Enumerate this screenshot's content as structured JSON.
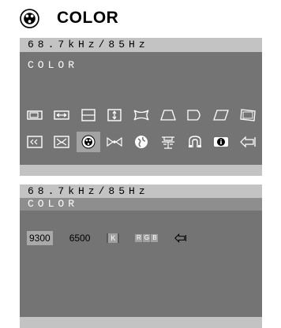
{
  "header": {
    "title": "COLOR",
    "icon": "color-palette-icon"
  },
  "osd_top": {
    "frequency": "68.7kHz/85Hz",
    "menu_name": "COLOR",
    "row1_icons": [
      "size-icon",
      "h-position-icon",
      "v-size-icon",
      "v-position-icon",
      "pincushion-icon",
      "trapezoid-icon",
      "pinbalance-icon",
      "parallelogram-icon",
      "rotation-icon"
    ],
    "row2_icons": [
      "moire-icon",
      "focus-icon",
      "color-palette-icon",
      "convergence-icon",
      "language-icon",
      "reset-icon",
      "degauss-icon",
      "information-icon",
      "exit-icon"
    ],
    "selected_icon": "color-palette-icon"
  },
  "osd_bottom": {
    "frequency": "68.7kHz/85Hz",
    "menu_name": "COLOR",
    "options": {
      "temp1": "9300",
      "temp2": "6500",
      "k_label": "K",
      "rgb_labels": [
        "R",
        "G",
        "B"
      ]
    },
    "selected_option": "9300"
  },
  "colors": {
    "osd_bg": "#747474",
    "band": "#c3c3c3",
    "selected": "#a3a3a3"
  }
}
